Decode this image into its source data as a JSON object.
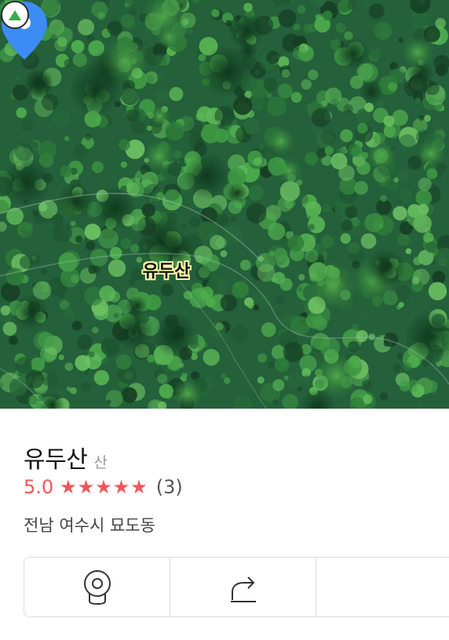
{
  "map": {
    "poi_label": "유두산",
    "pin_color": "#3d8cf4",
    "marker_icon": "mountain-icon"
  },
  "place": {
    "name": "유두산",
    "category": "산",
    "rating": "5.0",
    "stars": "★★★★★",
    "review_count": "(3)",
    "address": "전남 여수시 묘도동",
    "accent_color": "#f2565a"
  },
  "actions": [
    {
      "icon": "street-view-icon"
    },
    {
      "icon": "share-icon"
    },
    {
      "icon": "more-icon"
    }
  ]
}
